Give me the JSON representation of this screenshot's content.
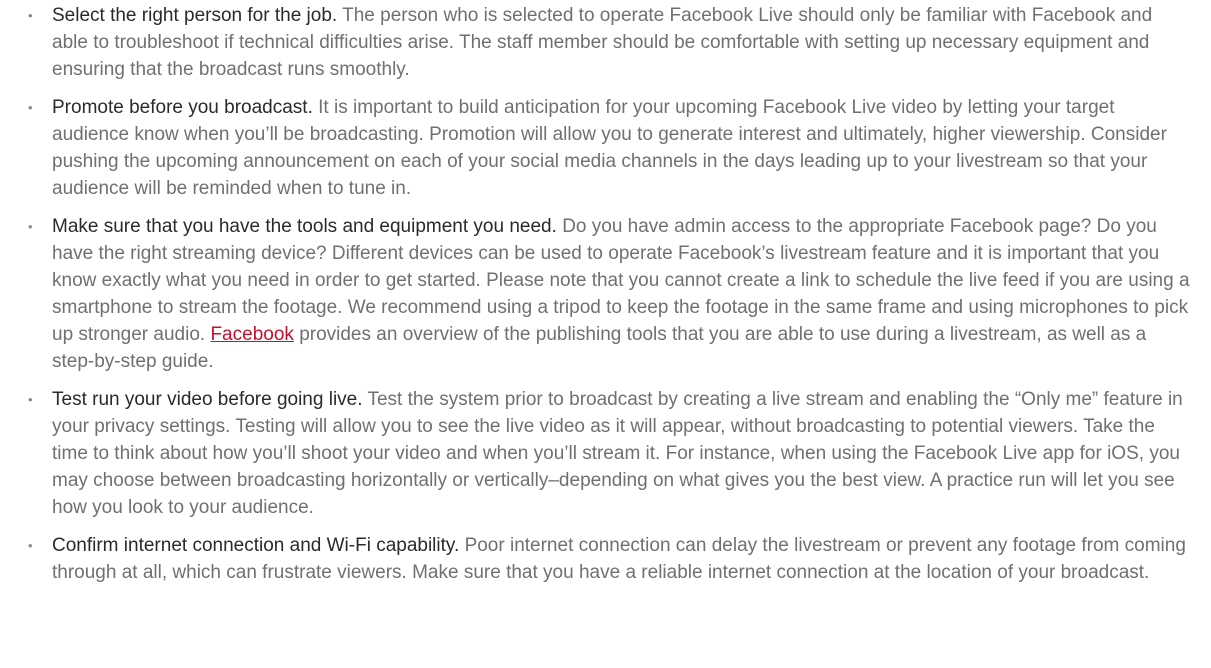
{
  "tips": [
    {
      "lead": "Select the right person for the job.",
      "body": "The person who is selected to operate Facebook Live should only be familiar with Facebook and able to troubleshoot if technical difficulties arise. The staff member should be comfortable with setting up necessary equipment and ensuring that the broadcast runs smoothly."
    },
    {
      "lead": "Promote before you broadcast.",
      "body": "It is important to build anticipation for your upcoming Facebook Live video by letting your target audience know when you’ll be broadcasting. Promotion will allow you to generate interest and ultimately, higher viewership. Consider pushing the upcoming announcement on each of your social media channels in the days leading up to your livestream so that your audience will be reminded when to tune in."
    },
    {
      "lead": "Make sure that you have the tools and equipment you need.",
      "body_before_link": "Do you have admin access to the appropriate Facebook page? Do you have the right streaming device? Different devices can be used to operate Facebook’s livestream feature and it is important that you know exactly what you need in order to get started. Please note that you cannot create a link to schedule the live feed if you are using a smartphone to stream the footage. We recommend using a tripod to keep the footage in the same frame and using microphones to pick up stronger audio.",
      "link_text": "Facebook",
      "body_after_link": "provides an overview of the publishing tools that you are able to use during a livestream, as well as a step-by-step guide."
    },
    {
      "lead": "Test run your video before going live.",
      "body": "Test the system prior to broadcast by creating a live stream and enabling the “Only me” feature in your privacy settings. Testing will allow you to see the live video as it will appear, without broadcasting to potential viewers. Take the time to think about how you’ll shoot your video and when you’ll stream it. For instance, when using the Facebook Live app for iOS, you may choose between broadcasting horizontally or vertically–depending on what gives you the best view. A practice run will let you see how you look to your audience."
    },
    {
      "lead": "Confirm internet connection and Wi-Fi capability.",
      "body": "Poor internet connection can delay the livestream or prevent any footage from coming through at all, which can frustrate viewers. Make sure that you have a reliable internet connection at the location of your broadcast."
    }
  ]
}
